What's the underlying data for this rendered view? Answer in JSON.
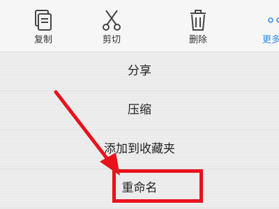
{
  "toolbar": {
    "copy": {
      "label": "复制",
      "icon": "copy-icon"
    },
    "cut": {
      "label": "剪切",
      "icon": "scissors-icon"
    },
    "delete": {
      "label": "删除",
      "icon": "trash-icon"
    },
    "more": {
      "label": "更多",
      "icon": "more-dots-icon"
    }
  },
  "menu": {
    "items": [
      {
        "label": "分享"
      },
      {
        "label": "压缩"
      },
      {
        "label": "添加到收藏夹"
      },
      {
        "label": "重命名"
      }
    ]
  },
  "annotation": {
    "color": "#e8121c",
    "target": "重命名"
  }
}
